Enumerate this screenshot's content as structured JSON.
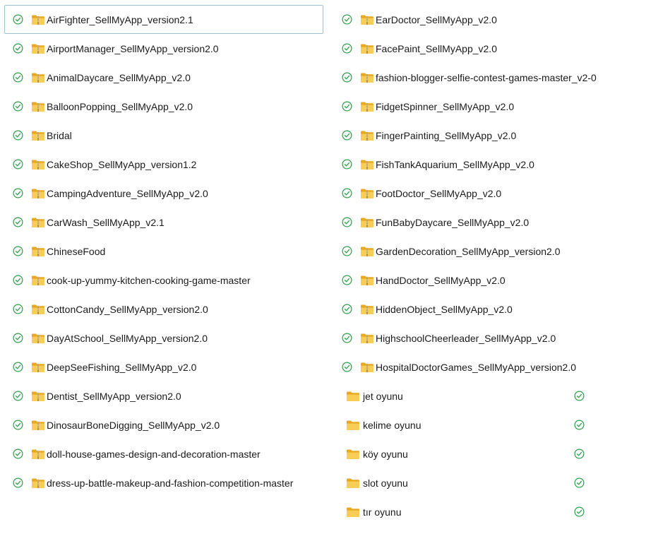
{
  "colors": {
    "check": "#2e9e4a",
    "folder_back": "#e8a820",
    "folder_front": "#f7cd55",
    "selection_border": "#9dc3d8"
  },
  "icons": {
    "sync": "check-circle-icon",
    "folder": "folder-icon",
    "zip": "zip-folder-icon"
  },
  "left_items": [
    {
      "name": "AirFighter_SellMyApp_version2.1",
      "selected": true
    },
    {
      "name": "AirportManager_SellMyApp_version2.0"
    },
    {
      "name": "AnimalDaycare_SellMyApp_v2.0"
    },
    {
      "name": "BalloonPopping_SellMyApp_v2.0"
    },
    {
      "name": "Bridal"
    },
    {
      "name": "CakeShop_SellMyApp_version1.2"
    },
    {
      "name": "CampingAdventure_SellMyApp_v2.0"
    },
    {
      "name": "CarWash_SellMyApp_v2.1"
    },
    {
      "name": "ChineseFood"
    },
    {
      "name": "cook-up-yummy-kitchen-cooking-game-master"
    },
    {
      "name": "CottonCandy_SellMyApp_version2.0"
    },
    {
      "name": "DayAtSchool_SellMyApp_version2.0"
    },
    {
      "name": "DeepSeeFishing_SellMyApp_v2.0"
    },
    {
      "name": "Dentist_SellMyApp_version2.0"
    },
    {
      "name": "DinosaurBoneDigging_SellMyApp_v2.0"
    },
    {
      "name": "doll-house-games-design-and-decoration-master"
    },
    {
      "name": "dress-up-battle-makeup-and-fashion-competition-master"
    }
  ],
  "right_items": [
    {
      "name": "EarDoctor_SellMyApp_v2.0"
    },
    {
      "name": "FacePaint_SellMyApp_v2.0"
    },
    {
      "name": "fashion-blogger-selfie-contest-games-master_v2-0"
    },
    {
      "name": "FidgetSpinner_SellMyApp_v2.0"
    },
    {
      "name": "FingerPainting_SellMyApp_v2.0"
    },
    {
      "name": "FishTankAquarium_SellMyApp_v2.0"
    },
    {
      "name": "FootDoctor_SellMyApp_v2.0"
    },
    {
      "name": "FunBabyDaycare_SellMyApp_v2.0"
    },
    {
      "name": "GardenDecoration_SellMyApp_version2.0"
    },
    {
      "name": "HandDoctor_SellMyApp_v2.0"
    },
    {
      "name": "HiddenObject_SellMyApp_v2.0"
    },
    {
      "name": "HighschoolCheerleader_SellMyApp_v2.0"
    },
    {
      "name": "HospitalDoctorGames_SellMyApp_version2.0"
    }
  ],
  "right_folders": [
    {
      "name": "jet oyunu"
    },
    {
      "name": "kelime oyunu"
    },
    {
      "name": "köy oyunu"
    },
    {
      "name": "slot oyunu"
    },
    {
      "name": "tır oyunu"
    }
  ]
}
